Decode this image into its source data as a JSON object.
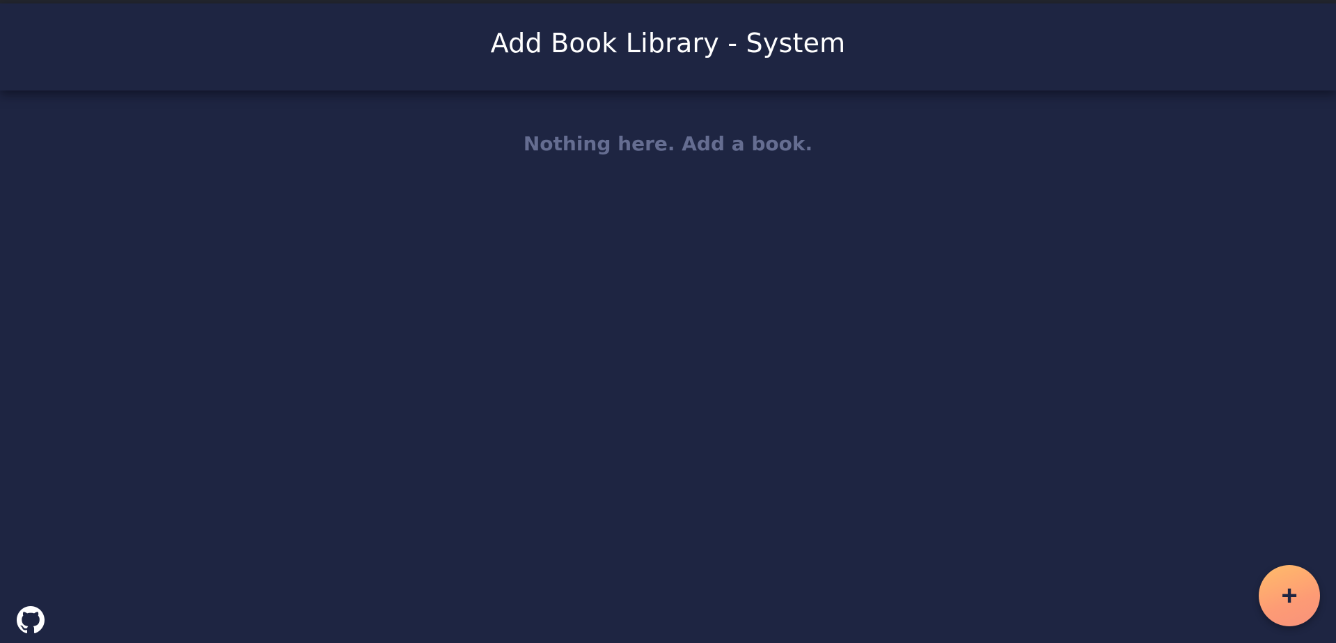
{
  "header": {
    "title": "Add Book Library - System"
  },
  "main": {
    "empty_message": "Nothing here. Add a book."
  },
  "footer": {
    "github_icon": "github-icon"
  },
  "fab": {
    "label": "+"
  },
  "colors": {
    "background": "#1e2542",
    "title_text": "#ffffff",
    "muted_text": "#656d91",
    "fab_gradient_start": "#ffbc6a",
    "fab_gradient_end": "#f8927b"
  }
}
